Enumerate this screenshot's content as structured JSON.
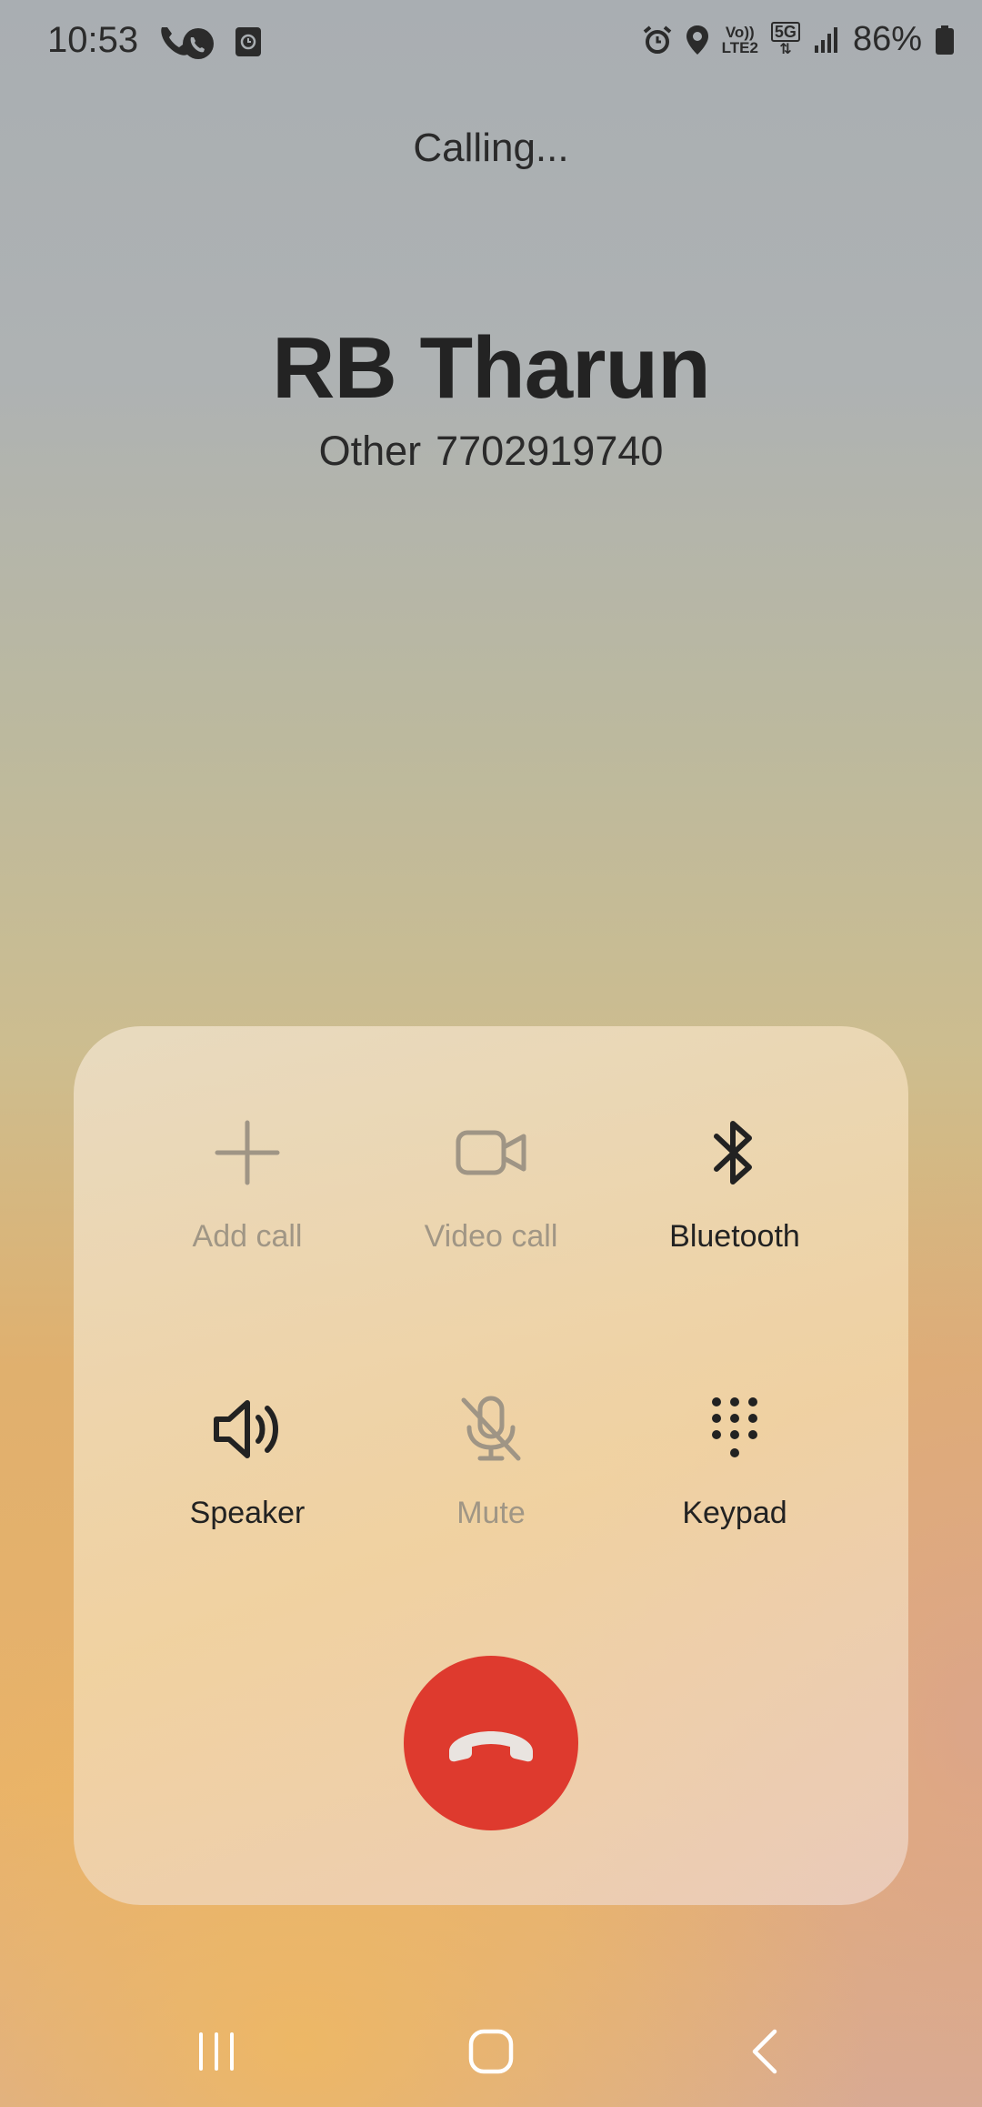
{
  "status_bar": {
    "time": "10:53",
    "battery": "86%",
    "left_icons": [
      "phone-call-icon",
      "screen-recorder-icon"
    ],
    "right_icons": [
      "alarm-icon",
      "location-icon",
      "volte-lte2-icon",
      "5g-icon",
      "signal-icon",
      "battery-icon"
    ],
    "volte_label": "Vo))",
    "lte_label": "LTE2",
    "network_label": "5G"
  },
  "call": {
    "status": "Calling...",
    "name": "RB Tharun",
    "number_label": "Other",
    "number": "7702919740"
  },
  "controls": [
    {
      "label": "Add call",
      "icon": "plus-icon",
      "enabled": false
    },
    {
      "label": "Video call",
      "icon": "video-camera-icon",
      "enabled": false
    },
    {
      "label": "Bluetooth",
      "icon": "bluetooth-icon",
      "enabled": true
    },
    {
      "label": "Speaker",
      "icon": "speaker-icon",
      "enabled": true
    },
    {
      "label": "Mute",
      "icon": "mic-off-icon",
      "enabled": false
    },
    {
      "label": "Keypad",
      "icon": "keypad-icon",
      "enabled": true
    }
  ],
  "end_call": {
    "icon": "end-call-icon",
    "color": "#de3a2e"
  },
  "nav": {
    "buttons": [
      "recent-apps-icon",
      "home-icon",
      "back-icon"
    ]
  },
  "colors": {
    "enabled_text": "#222222",
    "disabled_text": "#a09685",
    "end_call": "#de3a2e"
  }
}
